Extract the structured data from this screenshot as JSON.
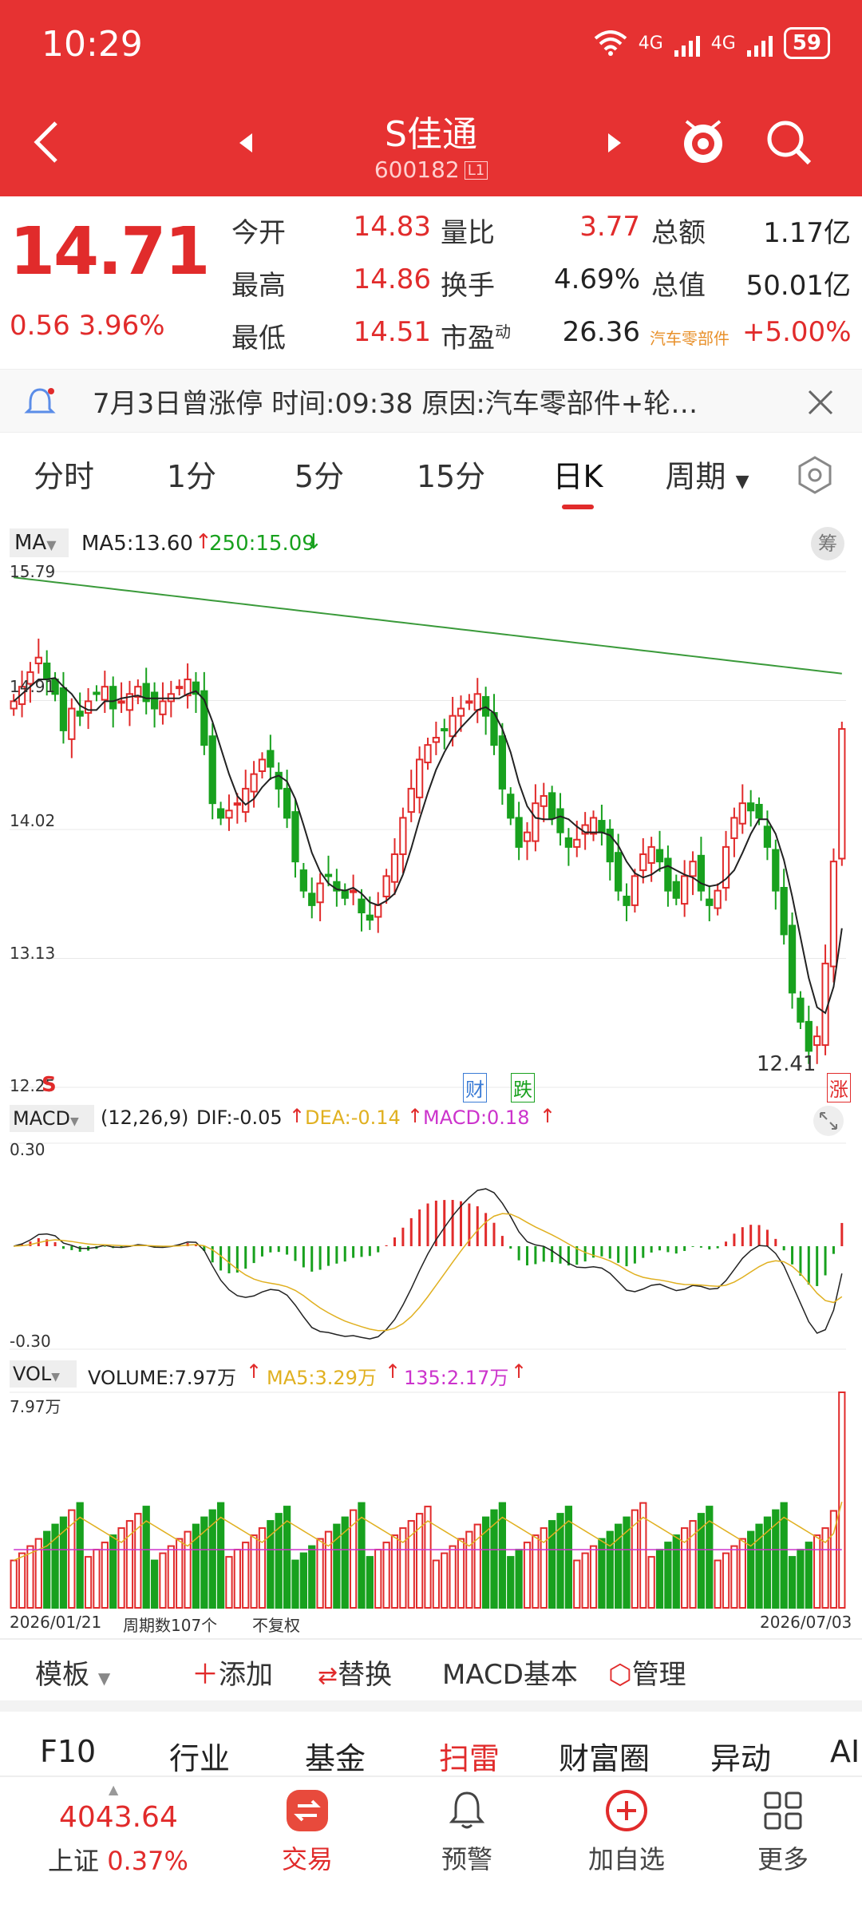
{
  "status": {
    "time": "10:29",
    "battery": "59",
    "net1": "4G",
    "net2": "4G"
  },
  "header": {
    "name": "S佳通",
    "code": "600182",
    "badge": "L1"
  },
  "quote": {
    "price": "14.71",
    "change": "0.56",
    "pct": "3.96%",
    "rows": [
      {
        "l1": "今开",
        "v1": "14.83",
        "l2": "量比",
        "v2": "3.77",
        "l3": "总额",
        "v3": "1.17亿"
      },
      {
        "l1": "最高",
        "v1": "14.86",
        "l2": "换手",
        "v2": "4.69%",
        "l3": "总值",
        "v3": "50.01亿"
      },
      {
        "l1": "最低",
        "v1": "14.51",
        "l2": "市盈",
        "v2": "26.36",
        "l3": "汽车零部件",
        "v3": "+5.00%"
      }
    ],
    "pe_sup": "动"
  },
  "alert": {
    "text": "7月3日曾涨停  时间:09:38  原因:汽车零部件+轮…"
  },
  "tabs": [
    "分时",
    "1分",
    "5分",
    "15分",
    "日K",
    "周期"
  ],
  "chart": {
    "ma_btn": "MA",
    "ma5": "MA5:13.60",
    "ma250": "250:15.09",
    "chip_btn": "筹",
    "p_ticks": [
      "15.79",
      "14.91",
      "14.02",
      "13.13",
      "12.25"
    ],
    "low_label": "12.41",
    "s_mark": "S",
    "cai": "财",
    "die": "跌",
    "zhang": "涨",
    "macd_btn": "MACD",
    "macd_params": "(12,26,9)",
    "dif": "DIF:-0.05",
    "dea": "DEA:-0.14",
    "macd": "MACD:0.18",
    "m_top": "0.30",
    "m_bot": "-0.30",
    "vol_btn": "VOL",
    "volume": "VOLUME:7.97万",
    "vma5": "MA5:3.29万",
    "v135": "135:2.17万",
    "v_top": "7.97万",
    "date_start": "2026/01/21",
    "cycles": "周期数107个",
    "adjust": "不复权",
    "date_end": "2026/07/03"
  },
  "tools": {
    "template": "模板",
    "add": "添加",
    "replace": "替换",
    "macd_basic": "MACD基本",
    "manage": "管理"
  },
  "subtabs": [
    "F10",
    "行业",
    "基金",
    "扫雷",
    "财富圈",
    "异动",
    "AI"
  ],
  "bottom": {
    "index_val": "4043.64",
    "index_name": "上证",
    "index_pct": "0.37%",
    "trade": "交易",
    "alert": "预警",
    "watch": "加自选",
    "more": "更多"
  },
  "colors": {
    "red": "#e12b2b",
    "green": "#18a11e",
    "ma250": "#3a9a3a",
    "dea": "#e0b020",
    "vma": "#cc33cc"
  },
  "chart_data": {
    "type": "candlestick",
    "price_ylim": [
      12.25,
      15.79
    ],
    "ohlc_close": [
      14.9,
      15.0,
      15.1,
      15.2,
      15.05,
      14.95,
      14.7,
      14.85,
      14.8,
      14.9,
      14.95,
      15.0,
      14.85,
      14.9,
      14.95,
      15.0,
      14.9,
      14.85,
      14.9,
      14.95,
      15.0,
      15.05,
      14.95,
      14.6,
      14.2,
      14.1,
      14.15,
      14.2,
      14.3,
      14.4,
      14.5,
      14.45,
      14.3,
      14.1,
      13.8,
      13.6,
      13.5,
      13.65,
      13.7,
      13.6,
      13.55,
      13.6,
      13.45,
      13.4,
      13.5,
      13.7,
      13.85,
      14.1,
      14.3,
      14.5,
      14.6,
      14.65,
      14.7,
      14.8,
      14.85,
      14.9,
      14.95,
      14.8,
      14.6,
      14.3,
      14.1,
      13.9,
      14.0,
      14.2,
      14.25,
      14.1,
      14.0,
      13.9,
      13.95,
      14.05,
      14.1,
      14.0,
      13.8,
      13.6,
      13.5,
      13.7,
      13.85,
      13.9,
      13.8,
      13.6,
      13.55,
      13.7,
      13.8,
      13.6,
      13.5,
      13.6,
      13.9,
      14.1,
      14.2,
      14.15,
      14.1,
      13.9,
      13.6,
      13.3,
      12.9,
      12.7,
      12.5,
      12.6,
      13.1,
      13.8,
      14.71
    ],
    "ma5": 13.6,
    "ma250": 15.09,
    "macd": {
      "dif": -0.05,
      "dea": -0.14,
      "hist": 0.18,
      "ylim": [
        -0.3,
        0.3
      ]
    },
    "volume": {
      "last": "7.97万",
      "ma5": "3.29万",
      "ma135": "2.17万",
      "ymax": "7.97万"
    },
    "x_range": [
      "2026/01/21",
      "2026/07/03"
    ],
    "count": 107
  }
}
